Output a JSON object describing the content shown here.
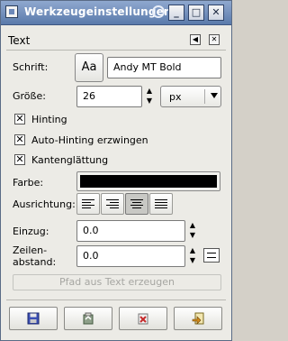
{
  "window": {
    "title": "Werkzeugeinstellungen"
  },
  "dock": {
    "title": "Text"
  },
  "font": {
    "label": "Schrift:",
    "button_glyph": "Aa",
    "value": "Andy MT Bold"
  },
  "size": {
    "label": "Größe:",
    "value": "26",
    "unit": "px"
  },
  "options": {
    "hinting": "Hinting",
    "autohinting": "Auto-Hinting erzwingen",
    "antialias": "Kantenglättung"
  },
  "color": {
    "label": "Farbe:",
    "value": "#000000"
  },
  "justify": {
    "label": "Ausrichtung:",
    "selected": "center"
  },
  "indent": {
    "label": "Einzug:",
    "value": "0.0"
  },
  "line_spacing": {
    "label_line1": "Zeilen-",
    "label_line2": "abstand:",
    "value": "0.0"
  },
  "path_button": {
    "label": "Pfad aus Text erzeugen"
  },
  "icons": {
    "titlebar": [
      "window-menu-icon",
      "shade-icon",
      "minimize-icon",
      "maximize-icon",
      "close-icon"
    ],
    "bottom": [
      "save-icon",
      "restore-icon",
      "delete-icon",
      "reset-icon"
    ]
  }
}
